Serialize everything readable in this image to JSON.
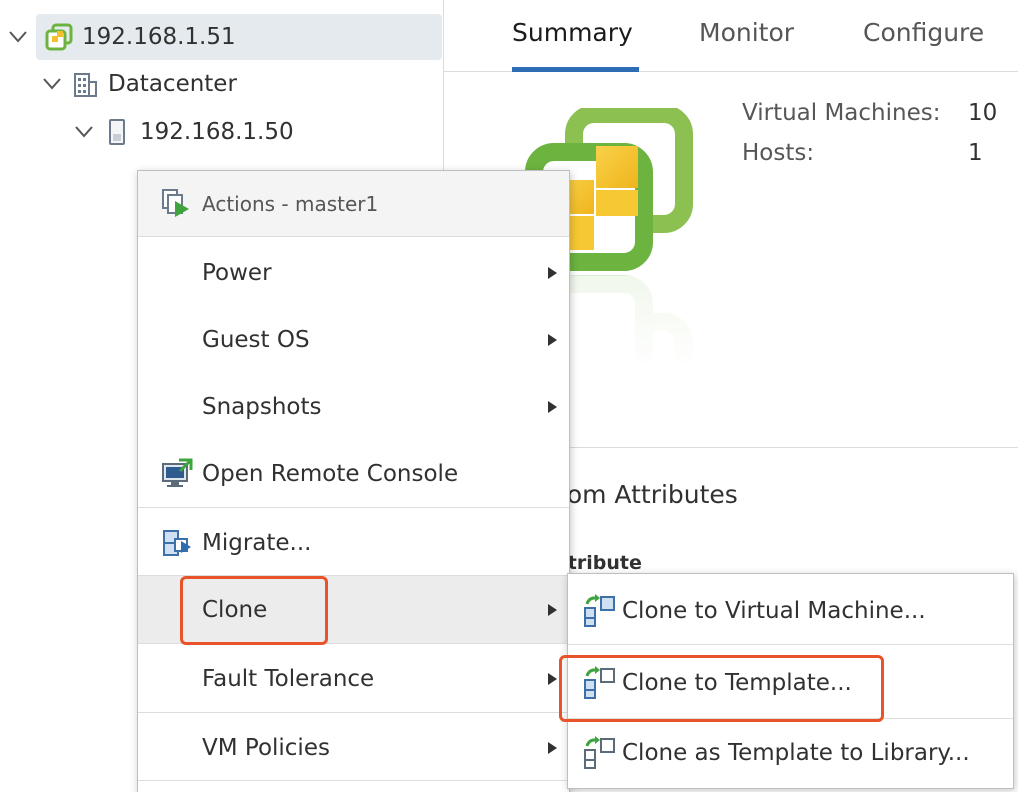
{
  "tree": {
    "items": [
      {
        "label": "192.168.1.51",
        "icon": "vcenter-icon"
      },
      {
        "label": "Datacenter",
        "icon": "datacenter-icon"
      },
      {
        "label": "192.168.1.50",
        "icon": "host-icon"
      }
    ]
  },
  "tabs": [
    {
      "label": "Summary"
    },
    {
      "label": "Monitor"
    },
    {
      "label": "Configure"
    }
  ],
  "summary": {
    "stats": [
      {
        "label": "Virtual Machines:",
        "value": "10"
      },
      {
        "label": "Hosts:",
        "value": "1"
      }
    ]
  },
  "attributes": {
    "title": "stom Attributes",
    "column_header": "Attribute"
  },
  "context_menu": {
    "header": "Actions - master1",
    "items": [
      {
        "label": "Power",
        "submenu": true
      },
      {
        "label": "Guest OS",
        "submenu": true
      },
      {
        "label": "Snapshots",
        "submenu": true
      },
      {
        "label": "Open Remote Console",
        "icon": "remote-console-icon"
      },
      {
        "label": "Migrate...",
        "icon": "migrate-icon"
      },
      {
        "label": "Clone",
        "submenu": true,
        "hovered": true
      },
      {
        "label": "Fault Tolerance",
        "submenu": true
      },
      {
        "label": "VM Policies",
        "submenu": true
      }
    ]
  },
  "clone_submenu": {
    "items": [
      {
        "label": "Clone to Virtual Machine...",
        "icon": "clone-vm-icon"
      },
      {
        "label": "Clone to Template...",
        "icon": "clone-template-icon",
        "highlighted": true
      },
      {
        "label": "Clone as Template to Library...",
        "icon": "clone-library-icon"
      }
    ]
  },
  "colors": {
    "accent": "#2e6db4",
    "highlight": "#e8532a",
    "vmware_green": "#6db33f",
    "vmware_yellow": "#f3c12d"
  }
}
